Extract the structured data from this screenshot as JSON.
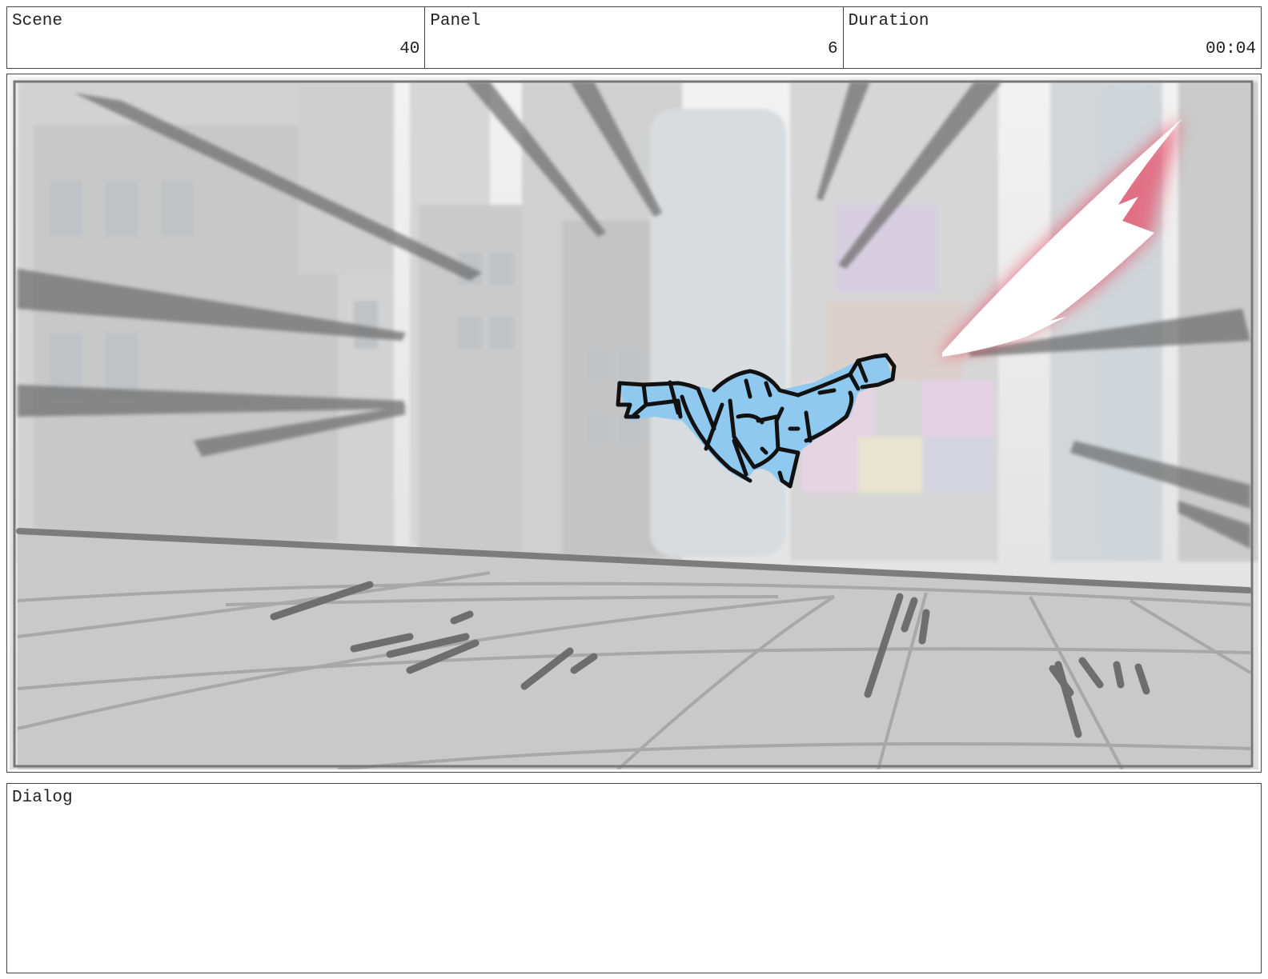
{
  "header": {
    "scene": {
      "label": "Scene",
      "value": "40"
    },
    "panel": {
      "label": "Panel",
      "value": "6"
    },
    "duration": {
      "label": "Duration",
      "value": "00:04"
    }
  },
  "storyboard": {
    "image_subject": "superhero-flying-through-city",
    "colors": {
      "hero": "#8fc9ef",
      "blast": "#e8506a",
      "ground": "#c9c9c9",
      "sky": "#f4f4f4"
    }
  },
  "dialog": {
    "label": "Dialog",
    "text": ""
  }
}
